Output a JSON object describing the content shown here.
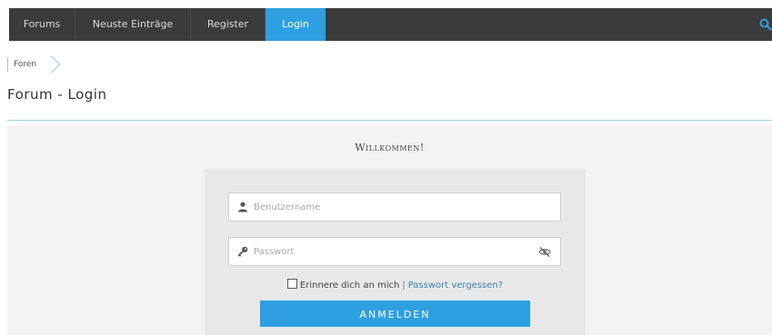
{
  "nav": {
    "items": [
      {
        "label": "Forums",
        "active": false
      },
      {
        "label": "Neuste Einträge",
        "active": false
      },
      {
        "label": "Register",
        "active": false
      },
      {
        "label": "Login",
        "active": true
      }
    ],
    "search_icon": "search-icon",
    "bg_color": "#3b3b3b",
    "accent_color": "#2e9fe0"
  },
  "breadcrumb": {
    "items": [
      "Foren"
    ]
  },
  "page": {
    "title": "Forum - Login"
  },
  "login": {
    "welcome": "Willkommen!",
    "username": {
      "placeholder": "Benutzername",
      "value": "",
      "icon": "user-icon"
    },
    "password": {
      "placeholder": "Passwort",
      "value": "",
      "icon": "key-icon",
      "toggle_icon": "eye-slash-icon"
    },
    "remember_label": "Erinnere dich an mich",
    "remember_checked": false,
    "separator": "|",
    "forgot_link": "Passwort vergessen?",
    "submit_label": "ANMELDEN"
  }
}
